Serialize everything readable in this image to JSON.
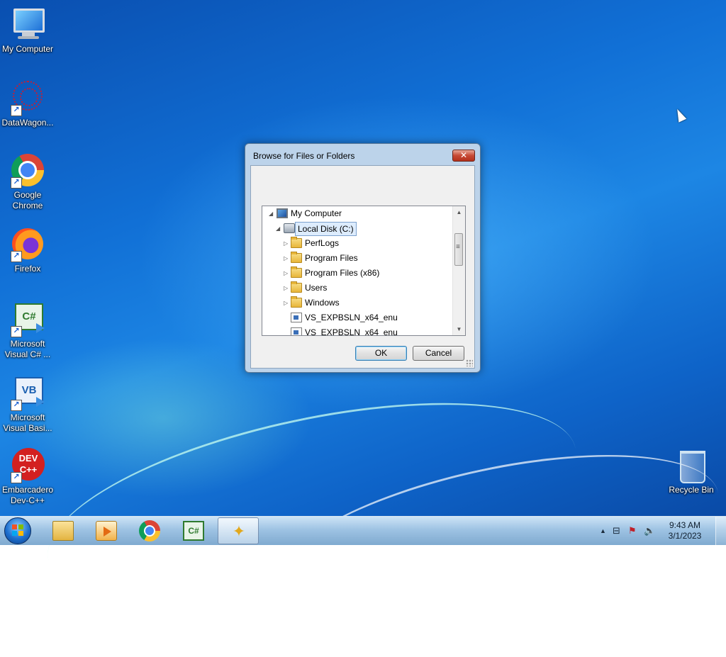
{
  "desktop": {
    "icons": [
      {
        "label": "My Computer",
        "icon": "computer-icon"
      },
      {
        "label": "DataWagon...",
        "icon": "datawagon-icon"
      },
      {
        "label": "Google Chrome",
        "icon": "chrome-icon"
      },
      {
        "label": "Firefox",
        "icon": "firefox-icon"
      },
      {
        "label": "Microsoft Visual C# ...",
        "icon": "visual-csharp-icon"
      },
      {
        "label": "Microsoft Visual Basi...",
        "icon": "visual-basic-icon"
      },
      {
        "label": "Embarcadero Dev-C++",
        "icon": "dev-cpp-icon",
        "logo_text": "DEV C++"
      },
      {
        "label": "Recycle Bin",
        "icon": "recycle-bin-icon"
      }
    ]
  },
  "dialog": {
    "title": "Browse for Files or Folders",
    "close_label": "✕",
    "tree": [
      {
        "label": "My Computer",
        "expanded": true,
        "icon": "computer-icon",
        "level": 0
      },
      {
        "label": "Local Disk (C:)",
        "expanded": true,
        "selected": true,
        "icon": "drive-icon",
        "level": 1
      },
      {
        "label": "PerfLogs",
        "expanded": false,
        "icon": "folder-icon",
        "level": 2
      },
      {
        "label": "Program Files",
        "expanded": false,
        "icon": "folder-icon",
        "level": 2
      },
      {
        "label": "Program Files (x86)",
        "expanded": false,
        "icon": "folder-icon",
        "level": 2
      },
      {
        "label": "Users",
        "expanded": false,
        "icon": "folder-icon",
        "level": 2
      },
      {
        "label": "Windows",
        "expanded": false,
        "icon": "folder-icon",
        "level": 2
      },
      {
        "label": "VS_EXPBSLN_x64_enu",
        "icon": "file-icon",
        "level": 2
      },
      {
        "label": "VS_EXPBSLN_x64_enu",
        "icon": "file-icon",
        "level": 2
      }
    ],
    "ok_label": "OK",
    "cancel_label": "Cancel"
  },
  "taskbar": {
    "pinned": [
      "windows-explorer-icon",
      "media-player-icon",
      "chrome-icon",
      "visual-csharp-icon",
      "setup-wizard-icon"
    ],
    "active_index": 4,
    "clock_time": "9:43 AM",
    "clock_date": "3/1/2023",
    "tray_arrow": "▲",
    "tray_icons": [
      "network-icon",
      "action-center-icon",
      "volume-icon"
    ]
  },
  "colors": {
    "desktop_blue": "#1170d6",
    "dialog_frame": "#bcd3ea",
    "selection": "#ddecfd",
    "close_red": "#c74a35"
  }
}
